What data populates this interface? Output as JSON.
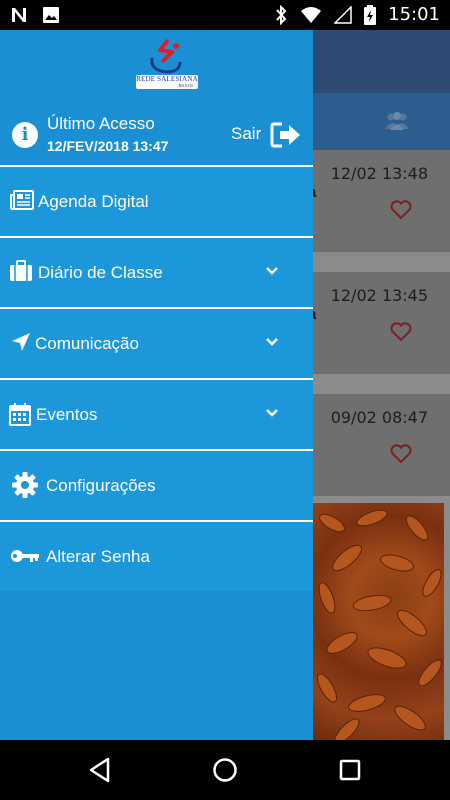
{
  "status_bar": {
    "time": "15:01",
    "left_icons": [
      "notification-n-icon",
      "image-icon"
    ],
    "right_icons": [
      "bluetooth-icon",
      "wifi-icon",
      "signal-icon",
      "battery-charging-icon"
    ]
  },
  "background_app": {
    "cards": [
      {
        "time": "12/02 13:48",
        "fragment": "a"
      },
      {
        "time": "12/02 13:45",
        "fragment": "a"
      },
      {
        "time": "09/02 08:47",
        "fragment": ""
      }
    ]
  },
  "drawer": {
    "logo_text": "REDE SALESIANA",
    "logo_subtext": "BRASIL",
    "last_access_label": "Último Acesso",
    "last_access_date": "12/FEV/2018 13:47",
    "logout_label": "Sair",
    "menu": [
      {
        "label": "Agenda Digital",
        "icon": "newspaper-icon",
        "expandable": false
      },
      {
        "label": "Diário de Classe",
        "icon": "briefcase-icon",
        "expandable": true
      },
      {
        "label": "Comunicação",
        "icon": "location-arrow-icon",
        "expandable": true
      },
      {
        "label": "Eventos",
        "icon": "calendar-icon",
        "expandable": true
      },
      {
        "label": "Configurações",
        "icon": "gear-icon",
        "expandable": false
      },
      {
        "label": "Alterar Senha",
        "icon": "key-icon",
        "expandable": false
      }
    ]
  },
  "colors": {
    "drawer_bg": "#1a8fd4",
    "menu_item_bg": "#1c97d9",
    "heart": "#c0392b"
  }
}
